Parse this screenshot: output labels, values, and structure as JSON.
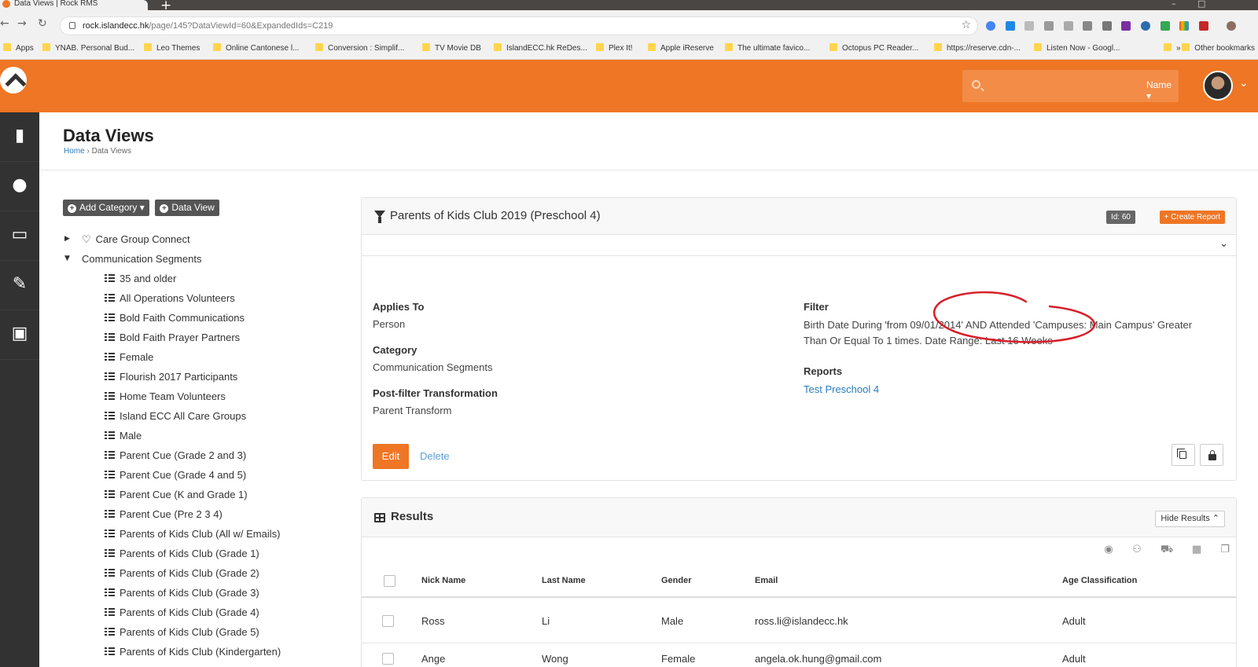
{
  "browser": {
    "tab_title": "Data Views | Rock RMS",
    "url_host": "rock.islandecc.hk",
    "url_path": "/page/145?DataViewId=60&ExpandedIds=C219",
    "bookmarks": [
      "Apps",
      "YNAB. Personal Bud...",
      "Leo Themes",
      "Online Cantonese l...",
      "Conversion : Simplif...",
      "TV Movie DB",
      "IslandECC.hk ReDes...",
      "Plex It!",
      "Apple iReserve",
      "The ultimate favico...",
      "Octopus PC Reader...",
      "https://reserve.cdn-...",
      "Listen Now - Googl..."
    ],
    "overflow": "»",
    "other_bookmarks": "Other bookmarks"
  },
  "header": {
    "search_type": "Name ▾"
  },
  "page": {
    "title": "Data Views",
    "breadcrumb_home": "Home",
    "breadcrumb_sep": "›",
    "breadcrumb_current": "Data Views"
  },
  "tree": {
    "add_category": "Add Category ▾",
    "add_dataview": "Data View",
    "categories": [
      {
        "label": "Care Group Connect",
        "expanded": false
      },
      {
        "label": "Communication Segments",
        "expanded": true
      }
    ],
    "items": [
      "35 and older",
      "All Operations Volunteers",
      "Bold Faith Communications",
      "Bold Faith Prayer Partners",
      "Female",
      "Flourish 2017 Participants",
      "Home Team Volunteers",
      "Island ECC All Care Groups",
      "Male",
      "Parent Cue (Grade 2 and 3)",
      "Parent Cue (Grade 4 and 5)",
      "Parent Cue (K and Grade 1)",
      "Parent Cue (Pre 2 3 4)",
      "Parents of Kids Club (All w/ Emails)",
      "Parents of Kids Club (Grade 1)",
      "Parents of Kids Club (Grade 2)",
      "Parents of Kids Club (Grade 3)",
      "Parents of Kids Club (Grade 4)",
      "Parents of Kids Club (Grade 5)",
      "Parents of Kids Club (Kindergarten)"
    ]
  },
  "detail": {
    "title": "Parents of Kids Club 2019 (Preschool 4)",
    "id_badge": "Id: 60",
    "create_report": "+ Create Report",
    "applies_to_label": "Applies To",
    "applies_to_value": "Person",
    "category_label": "Category",
    "category_value": "Communication Segments",
    "postfilter_label": "Post-filter Transformation",
    "postfilter_value": "Parent Transform",
    "filter_label": "Filter",
    "filter_value": "Birth Date During 'from 09/01/2014' AND Attended 'Campuses: Main Campus' Greater Than Or Equal To 1 times. Date Range: Last 16 Weeks",
    "reports_label": "Reports",
    "report_link": "Test Preschool 4",
    "edit": "Edit",
    "delete": "Delete"
  },
  "results": {
    "title": "Results",
    "hide_button": "Hide Results ⌃",
    "columns": [
      "Nick Name",
      "Last Name",
      "Gender",
      "Email",
      "Age Classification"
    ],
    "rows": [
      [
        "Ross",
        "Li",
        "Male",
        "ross.li@islandecc.hk",
        "Adult"
      ],
      [
        "Ange",
        "Wong",
        "Female",
        "angela.ok.hung@gmail.com",
        "Adult"
      ]
    ]
  },
  "colors": {
    "brand": "#ee7625",
    "rail": "#323232",
    "link": "#2a7bbf",
    "annotation": "#d81e2a"
  }
}
